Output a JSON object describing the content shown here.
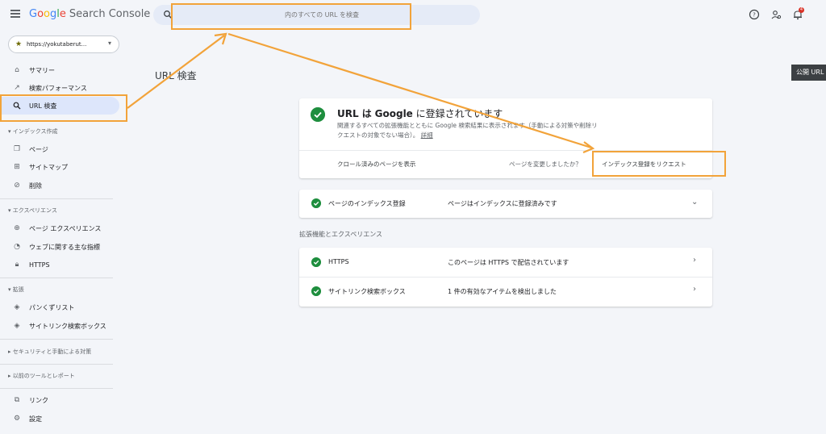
{
  "header": {
    "product_name": "Search Console",
    "search": {
      "placeholder": "内のすべての URL を検査"
    },
    "notification_count": "4"
  },
  "property": {
    "label": "https://yokutaberut..."
  },
  "sidebar": {
    "items": [
      {
        "label": "サマリー",
        "icon": "home-icon"
      },
      {
        "label": "検索パフォーマンス",
        "icon": "trending-icon"
      },
      {
        "label": "URL 検査",
        "icon": "search-icon",
        "active": true
      }
    ],
    "sections": [
      {
        "label": "インデックス作成",
        "items": [
          {
            "label": "ページ",
            "icon": "pages-icon"
          },
          {
            "label": "サイトマップ",
            "icon": "sitemap-icon"
          },
          {
            "label": "削除",
            "icon": "removal-icon"
          }
        ]
      },
      {
        "label": "エクスペリエンス",
        "items": [
          {
            "label": "ページ エクスペリエンス",
            "icon": "plus-circle-icon"
          },
          {
            "label": "ウェブに関する主な指標",
            "icon": "speed-icon"
          },
          {
            "label": "HTTPS",
            "icon": "lock-icon"
          }
        ]
      },
      {
        "label": "拡張",
        "items": [
          {
            "label": "パンくずリスト",
            "icon": "layers-icon"
          },
          {
            "label": "サイトリンク検索ボックス",
            "icon": "layers-icon"
          }
        ]
      },
      {
        "label": "セキュリティと手動による対策",
        "items": []
      },
      {
        "label": "以前のツールとレポート",
        "items": []
      }
    ],
    "bottom_items": [
      {
        "label": "リンク",
        "icon": "link-icon"
      },
      {
        "label": "設定",
        "icon": "gear-icon"
      }
    ]
  },
  "main": {
    "page_title": "URL 検査",
    "publish_button": "公開 URL",
    "status": {
      "title_prefix": "URL は",
      "title_brand": "Google",
      "title_suffix": "に登録されています",
      "description": "関連するすべての拡張機能とともに Google 検索結果に表示されます（手動による対策や削除リクエストの対象でない場合）。",
      "more_link": "詳細",
      "view_crawled": "クロール済みのページを表示",
      "changed_question": "ページを変更しましたか？",
      "request_indexing": "インデックス登録をリクエスト"
    },
    "indexing_row": {
      "label": "ページのインデックス登録",
      "value": "ページはインデックスに登録済みです"
    },
    "enhancements_heading": "拡張機能とエクスペリエンス",
    "enhancement_rows": [
      {
        "label": "HTTPS",
        "value": "このページは HTTPS で配信されています"
      },
      {
        "label": "サイトリンク検索ボックス",
        "value": "1 件の有効なアイテムを検出しました"
      }
    ]
  },
  "colors": {
    "accent_annotation": "#f2a33a",
    "success_green": "#1e8e3e",
    "active_nav_bg": "#dde6fb"
  }
}
